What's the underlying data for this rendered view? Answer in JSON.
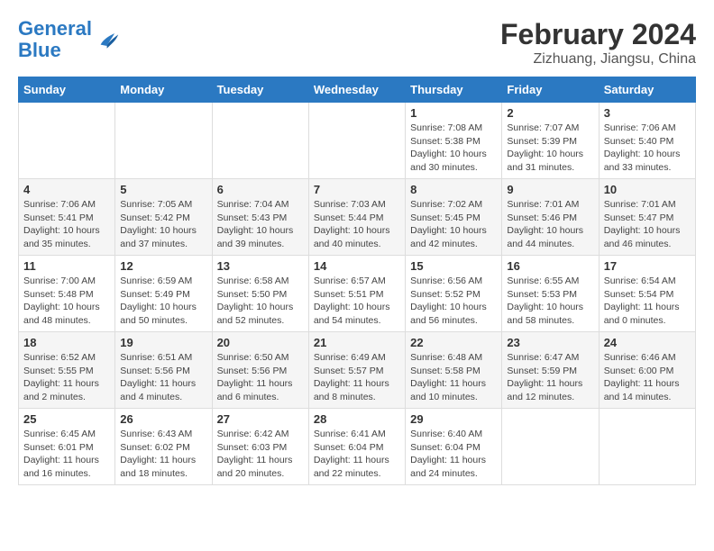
{
  "logo": {
    "general": "General",
    "blue": "Blue"
  },
  "title": "February 2024",
  "subtitle": "Zizhuang, Jiangsu, China",
  "days_of_week": [
    "Sunday",
    "Monday",
    "Tuesday",
    "Wednesday",
    "Thursday",
    "Friday",
    "Saturday"
  ],
  "weeks": [
    [
      {
        "day": "",
        "info": ""
      },
      {
        "day": "",
        "info": ""
      },
      {
        "day": "",
        "info": ""
      },
      {
        "day": "",
        "info": ""
      },
      {
        "day": "1",
        "info": "Sunrise: 7:08 AM\nSunset: 5:38 PM\nDaylight: 10 hours and 30 minutes."
      },
      {
        "day": "2",
        "info": "Sunrise: 7:07 AM\nSunset: 5:39 PM\nDaylight: 10 hours and 31 minutes."
      },
      {
        "day": "3",
        "info": "Sunrise: 7:06 AM\nSunset: 5:40 PM\nDaylight: 10 hours and 33 minutes."
      }
    ],
    [
      {
        "day": "4",
        "info": "Sunrise: 7:06 AM\nSunset: 5:41 PM\nDaylight: 10 hours and 35 minutes."
      },
      {
        "day": "5",
        "info": "Sunrise: 7:05 AM\nSunset: 5:42 PM\nDaylight: 10 hours and 37 minutes."
      },
      {
        "day": "6",
        "info": "Sunrise: 7:04 AM\nSunset: 5:43 PM\nDaylight: 10 hours and 39 minutes."
      },
      {
        "day": "7",
        "info": "Sunrise: 7:03 AM\nSunset: 5:44 PM\nDaylight: 10 hours and 40 minutes."
      },
      {
        "day": "8",
        "info": "Sunrise: 7:02 AM\nSunset: 5:45 PM\nDaylight: 10 hours and 42 minutes."
      },
      {
        "day": "9",
        "info": "Sunrise: 7:01 AM\nSunset: 5:46 PM\nDaylight: 10 hours and 44 minutes."
      },
      {
        "day": "10",
        "info": "Sunrise: 7:01 AM\nSunset: 5:47 PM\nDaylight: 10 hours and 46 minutes."
      }
    ],
    [
      {
        "day": "11",
        "info": "Sunrise: 7:00 AM\nSunset: 5:48 PM\nDaylight: 10 hours and 48 minutes."
      },
      {
        "day": "12",
        "info": "Sunrise: 6:59 AM\nSunset: 5:49 PM\nDaylight: 10 hours and 50 minutes."
      },
      {
        "day": "13",
        "info": "Sunrise: 6:58 AM\nSunset: 5:50 PM\nDaylight: 10 hours and 52 minutes."
      },
      {
        "day": "14",
        "info": "Sunrise: 6:57 AM\nSunset: 5:51 PM\nDaylight: 10 hours and 54 minutes."
      },
      {
        "day": "15",
        "info": "Sunrise: 6:56 AM\nSunset: 5:52 PM\nDaylight: 10 hours and 56 minutes."
      },
      {
        "day": "16",
        "info": "Sunrise: 6:55 AM\nSunset: 5:53 PM\nDaylight: 10 hours and 58 minutes."
      },
      {
        "day": "17",
        "info": "Sunrise: 6:54 AM\nSunset: 5:54 PM\nDaylight: 11 hours and 0 minutes."
      }
    ],
    [
      {
        "day": "18",
        "info": "Sunrise: 6:52 AM\nSunset: 5:55 PM\nDaylight: 11 hours and 2 minutes."
      },
      {
        "day": "19",
        "info": "Sunrise: 6:51 AM\nSunset: 5:56 PM\nDaylight: 11 hours and 4 minutes."
      },
      {
        "day": "20",
        "info": "Sunrise: 6:50 AM\nSunset: 5:56 PM\nDaylight: 11 hours and 6 minutes."
      },
      {
        "day": "21",
        "info": "Sunrise: 6:49 AM\nSunset: 5:57 PM\nDaylight: 11 hours and 8 minutes."
      },
      {
        "day": "22",
        "info": "Sunrise: 6:48 AM\nSunset: 5:58 PM\nDaylight: 11 hours and 10 minutes."
      },
      {
        "day": "23",
        "info": "Sunrise: 6:47 AM\nSunset: 5:59 PM\nDaylight: 11 hours and 12 minutes."
      },
      {
        "day": "24",
        "info": "Sunrise: 6:46 AM\nSunset: 6:00 PM\nDaylight: 11 hours and 14 minutes."
      }
    ],
    [
      {
        "day": "25",
        "info": "Sunrise: 6:45 AM\nSunset: 6:01 PM\nDaylight: 11 hours and 16 minutes."
      },
      {
        "day": "26",
        "info": "Sunrise: 6:43 AM\nSunset: 6:02 PM\nDaylight: 11 hours and 18 minutes."
      },
      {
        "day": "27",
        "info": "Sunrise: 6:42 AM\nSunset: 6:03 PM\nDaylight: 11 hours and 20 minutes."
      },
      {
        "day": "28",
        "info": "Sunrise: 6:41 AM\nSunset: 6:04 PM\nDaylight: 11 hours and 22 minutes."
      },
      {
        "day": "29",
        "info": "Sunrise: 6:40 AM\nSunset: 6:04 PM\nDaylight: 11 hours and 24 minutes."
      },
      {
        "day": "",
        "info": ""
      },
      {
        "day": "",
        "info": ""
      }
    ]
  ]
}
